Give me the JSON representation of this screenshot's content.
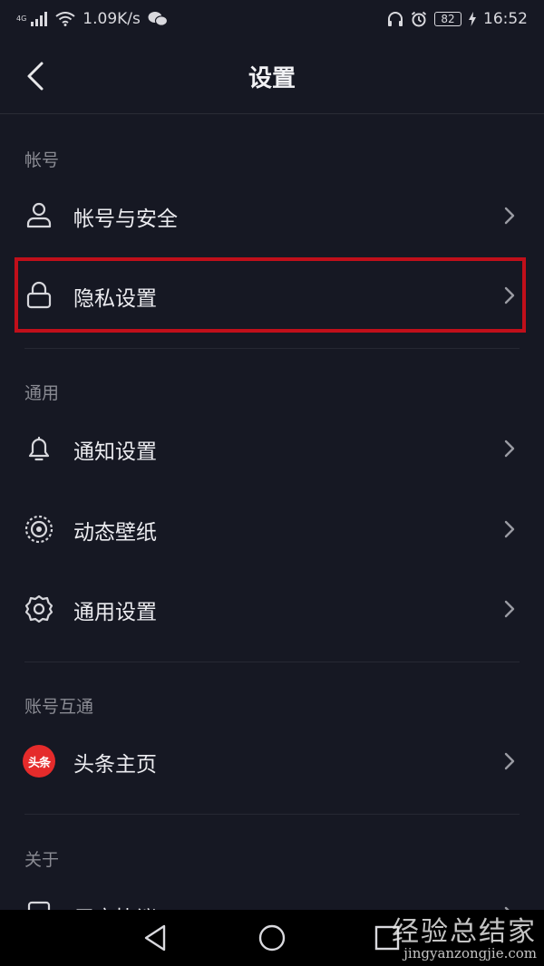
{
  "status_bar": {
    "network": "4G",
    "speed": "1.09K/s",
    "battery": "82",
    "time": "16:52"
  },
  "header": {
    "title": "设置"
  },
  "sections": {
    "account": {
      "label": "帐号",
      "items": [
        {
          "label": "帐号与安全",
          "icon": "user-icon"
        },
        {
          "label": "隐私设置",
          "icon": "lock-icon"
        }
      ]
    },
    "general": {
      "label": "通用",
      "items": [
        {
          "label": "通知设置",
          "icon": "bell-icon"
        },
        {
          "label": "动态壁纸",
          "icon": "live-wallpaper-icon"
        },
        {
          "label": "通用设置",
          "icon": "gear-icon"
        }
      ]
    },
    "linked": {
      "label": "账号互通",
      "items": [
        {
          "label": "头条主页",
          "icon": "toutiao-logo",
          "logo_text": "头条"
        }
      ]
    },
    "about": {
      "label": "关于",
      "items": [
        {
          "label": "用户协议",
          "icon": "document-icon"
        }
      ]
    }
  },
  "watermark": {
    "title": "经验总结家",
    "url": "jingyanzongjie.com"
  },
  "colors": {
    "background": "#161823",
    "highlight_border": "#c00f1a",
    "toutiao_red": "#e52b2b"
  }
}
